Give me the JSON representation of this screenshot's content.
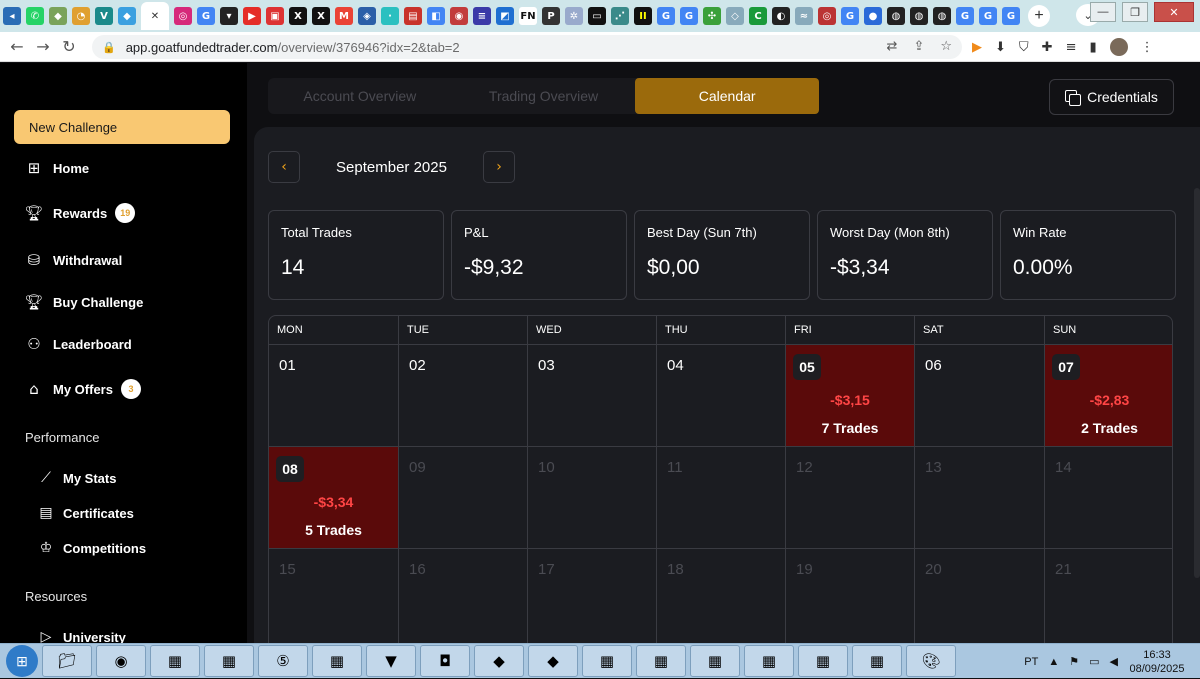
{
  "browser": {
    "url_host": "app.goatfundedtrader.com",
    "url_path": "/overview/376946?idx=2&tab=2"
  },
  "sidebar": {
    "new_challenge": "New Challenge",
    "items": [
      {
        "label": "Home",
        "icon": "grid-icon"
      },
      {
        "label": "Rewards",
        "icon": "trophy-icon",
        "badge": "19"
      },
      {
        "label": "Withdrawal",
        "icon": "withdrawal-icon"
      },
      {
        "label": "Buy Challenge",
        "icon": "trophy-icon"
      },
      {
        "label": "Leaderboard",
        "icon": "users-icon"
      },
      {
        "label": "My Offers",
        "icon": "tag-icon",
        "badge": "3"
      }
    ],
    "performance_label": "Performance",
    "performance_items": [
      {
        "label": "My Stats",
        "icon": "chart-icon"
      },
      {
        "label": "Certificates",
        "icon": "certificate-icon"
      },
      {
        "label": "Competitions",
        "icon": "crown-icon"
      }
    ],
    "resources_label": "Resources",
    "resources_items": [
      {
        "label": "University",
        "icon": "play-icon"
      }
    ]
  },
  "main": {
    "tabs": [
      "Account Overview",
      "Trading Overview",
      "Calendar"
    ],
    "active_tab": "Calendar",
    "credentials_label": "Credentials",
    "month_label": "September 2025",
    "stats": [
      {
        "title": "Total Trades",
        "value": "14"
      },
      {
        "title": "P&L",
        "value": "-$9,32"
      },
      {
        "title": "Best Day (Sun 7th)",
        "value": "$0,00"
      },
      {
        "title": "Worst Day (Mon 8th)",
        "value": "-$3,34"
      },
      {
        "title": "Win Rate",
        "value": "0.00%"
      }
    ],
    "weekdays": [
      "MON",
      "TUE",
      "WED",
      "THU",
      "FRI",
      "SAT",
      "SUN"
    ],
    "days": [
      {
        "n": "01"
      },
      {
        "n": "02"
      },
      {
        "n": "03"
      },
      {
        "n": "04"
      },
      {
        "n": "05",
        "pnl": "-$3,15",
        "trades": "7 Trades"
      },
      {
        "n": "06"
      },
      {
        "n": "07",
        "pnl": "-$2,83",
        "trades": "2 Trades"
      },
      {
        "n": "08",
        "pnl": "-$3,34",
        "trades": "5 Trades"
      },
      {
        "n": "09",
        "dim": true
      },
      {
        "n": "10",
        "dim": true
      },
      {
        "n": "11",
        "dim": true
      },
      {
        "n": "12",
        "dim": true
      },
      {
        "n": "13",
        "dim": true
      },
      {
        "n": "14",
        "dim": true
      },
      {
        "n": "15",
        "dim": true
      },
      {
        "n": "16",
        "dim": true
      },
      {
        "n": "17",
        "dim": true
      },
      {
        "n": "18",
        "dim": true
      },
      {
        "n": "19",
        "dim": true
      },
      {
        "n": "20",
        "dim": true
      },
      {
        "n": "21",
        "dim": true
      }
    ]
  },
  "taskbar": {
    "language": "PT",
    "time": "16:33",
    "date": "08/09/2025"
  }
}
